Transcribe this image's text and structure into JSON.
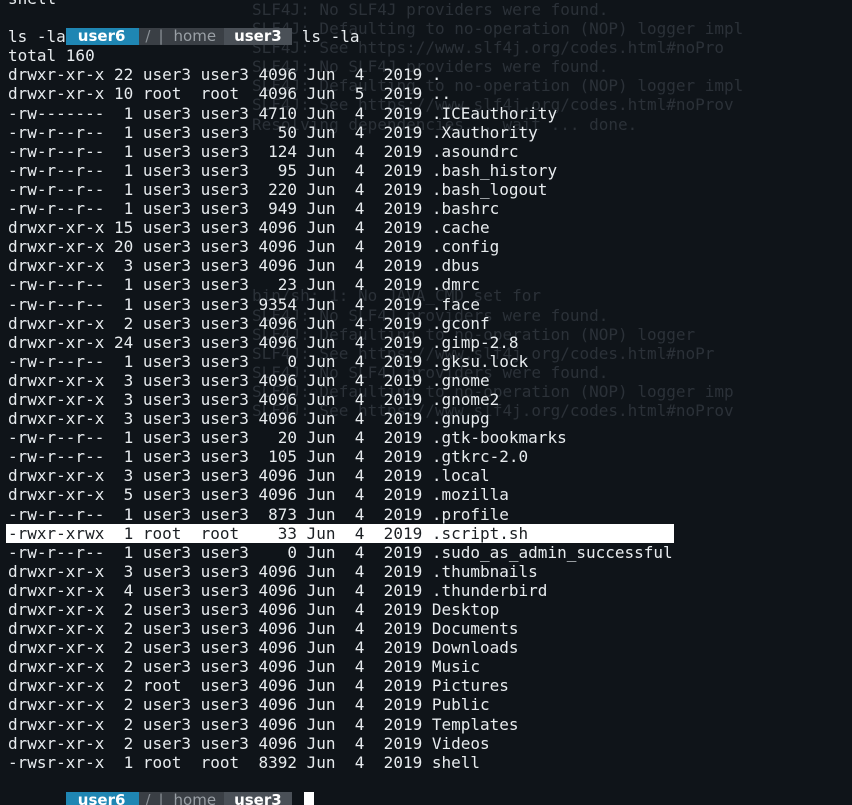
{
  "prompt": {
    "user": "user6",
    "root_sep": "/",
    "bar": "|",
    "home": "home",
    "cwd": "user3"
  },
  "top_partial": "shell",
  "command": "ls -la",
  "echo": "ls -la",
  "total": "total 160",
  "ghost_lines": [
    "SLF4J: No SLF4J providers were found.",
    "SLF4J: Defaulting to no-operation (NOP) logger impl",
    "SLF4J: See https://www.slf4j.org/codes.html#noPro",
    "SLF4J: No SLF4J providers were found.",
    "SLF4J: Defaulting to no-operation (NOP) logger impl",
    "SLF4J: See https://www.slf4j.org/codes.html#noProv",
    "Resolving dependencies... wait ... done.",
    "",
    "",
    "",
    "",
    "",
    "",
    "",
    "",
    "bin/sh: 1: No JAVA_CMD set for",
    "SLF4J: No SLF4J providers were found.",
    "SLF4J: Defaulting to no-operation (NOP) logger",
    "SLF4J: See https://www.slf4j.org/codes.html#noPr",
    "SLF4J: No SLF4J providers were found.",
    "SLF4J: Defaulting to no-operation (NOP) logger imp",
    "SLF4J: See https://www.slf4j.org/codes.html#noProv"
  ],
  "listing": [
    "drwxr-xr-x 22 user3 user3 4096 Jun  4  2019 .",
    "drwxr-xr-x 10 root  root  4096 Jun  5  2019 ..",
    "-rw-------  1 user3 user3 4710 Jun  4  2019 .ICEauthority",
    "-rw-r--r--  1 user3 user3   50 Jun  4  2019 .Xauthority",
    "-rw-r--r--  1 user3 user3  124 Jun  4  2019 .asoundrc",
    "-rw-r--r--  1 user3 user3   95 Jun  4  2019 .bash_history",
    "-rw-r--r--  1 user3 user3  220 Jun  4  2019 .bash_logout",
    "-rw-r--r--  1 user3 user3  949 Jun  4  2019 .bashrc",
    "drwxr-xr-x 15 user3 user3 4096 Jun  4  2019 .cache",
    "drwxr-xr-x 20 user3 user3 4096 Jun  4  2019 .config",
    "drwxr-xr-x  3 user3 user3 4096 Jun  4  2019 .dbus",
    "-rw-r--r--  1 user3 user3   23 Jun  4  2019 .dmrc",
    "-rw-r--r--  1 user3 user3 9354 Jun  4  2019 .face",
    "drwxr-xr-x  2 user3 user3 4096 Jun  4  2019 .gconf",
    "drwxr-xr-x 24 user3 user3 4096 Jun  4  2019 .gimp-2.8",
    "-rw-r--r--  1 user3 user3    0 Jun  4  2019 .gksu.lock",
    "drwxr-xr-x  3 user3 user3 4096 Jun  4  2019 .gnome",
    "drwxr-xr-x  3 user3 user3 4096 Jun  4  2019 .gnome2",
    "drwxr-xr-x  3 user3 user3 4096 Jun  4  2019 .gnupg",
    "-rw-r--r--  1 user3 user3   20 Jun  4  2019 .gtk-bookmarks",
    "-rw-r--r--  1 user3 user3  105 Jun  4  2019 .gtkrc-2.0",
    "drwxr-xr-x  3 user3 user3 4096 Jun  4  2019 .local",
    "drwxr-xr-x  5 user3 user3 4096 Jun  4  2019 .mozilla",
    "-rw-r--r--  1 user3 user3  873 Jun  4  2019 .profile",
    "-rwxr-xrwx  1 root  root    33 Jun  4  2019 .script.sh",
    "-rw-r--r--  1 user3 user3    0 Jun  4  2019 .sudo_as_admin_successful",
    "drwxr-xr-x  3 user3 user3 4096 Jun  4  2019 .thumbnails",
    "drwxr-xr-x  4 user3 user3 4096 Jun  4  2019 .thunderbird",
    "drwxr-xr-x  2 user3 user3 4096 Jun  4  2019 Desktop",
    "drwxr-xr-x  2 user3 user3 4096 Jun  4  2019 Documents",
    "drwxr-xr-x  2 user3 user3 4096 Jun  4  2019 Downloads",
    "drwxr-xr-x  2 user3 user3 4096 Jun  4  2019 Music",
    "drwxr-xr-x  2 root  user3 4096 Jun  4  2019 Pictures",
    "drwxr-xr-x  2 user3 user3 4096 Jun  4  2019 Public",
    "drwxr-xr-x  2 user3 user3 4096 Jun  4  2019 Templates",
    "drwxr-xr-x  2 user3 user3 4096 Jun  4  2019 Videos",
    "-rwsr-xr-x  1 root  root  8392 Jun  4  2019 shell"
  ],
  "highlight_entry": ".script.sh",
  "colors": {
    "background": "#0f1419",
    "foreground": "#e8ecef",
    "prompt_user": "#1f86b3",
    "prompt_path": "#3a3f45",
    "highlight": "#ffffff"
  }
}
